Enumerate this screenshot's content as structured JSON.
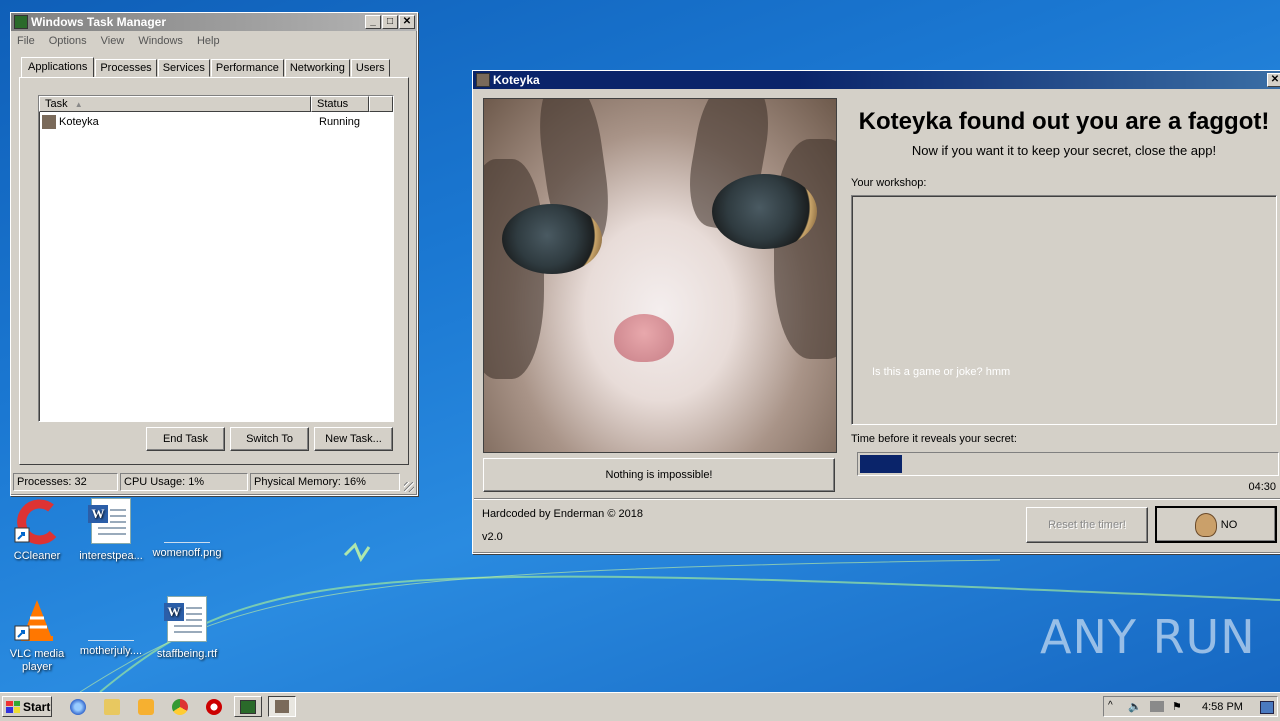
{
  "desktop": {
    "icons": [
      {
        "label": "CCleaner",
        "icon": "ccleaner-icon"
      },
      {
        "label": "interestpea...",
        "icon": "word-doc-icon"
      },
      {
        "label": "womenoff.png",
        "icon": "png-file-icon"
      },
      {
        "label": "VLC media player",
        "icon": "vlc-icon"
      },
      {
        "label": "motherjuly....",
        "icon": "file-icon"
      },
      {
        "label": "staffbeing.rtf",
        "icon": "word-doc-icon"
      }
    ],
    "watermark": "ANY RUN"
  },
  "taskmgr": {
    "title": "Windows Task Manager",
    "menu": [
      "File",
      "Options",
      "View",
      "Windows",
      "Help"
    ],
    "tabs": [
      "Applications",
      "Processes",
      "Services",
      "Performance",
      "Networking",
      "Users"
    ],
    "columns": [
      "Task",
      "Status"
    ],
    "rows": [
      {
        "task": "Koteyka",
        "status": "Running"
      }
    ],
    "buttons": {
      "end": "End Task",
      "switch": "Switch To",
      "new": "New Task..."
    },
    "status": {
      "processes": "Processes: 32",
      "cpu": "CPU Usage: 1%",
      "memory": "Physical Memory: 16%"
    }
  },
  "koteyka": {
    "title": "Koteyka",
    "heading": "Koteyka found out you are a faggot!",
    "subheading": "Now if you want it to keep your secret, close the app!",
    "workshop_label": "Your workshop:",
    "workshop_text": "Is this a game or joke? hmm",
    "nothing_button": "Nothing is impossible!",
    "timer_label": "Time before it reveals your secret:",
    "progress": 0.1,
    "time": "04:30",
    "credits": "Hardcoded by Enderman © 2018",
    "version": "v2.0",
    "reset_button": "Reset the timer!",
    "no_button": "NO"
  },
  "taskbar": {
    "start": "Start",
    "clock": "4:58 PM"
  },
  "colors": {
    "progress": "#0a246a",
    "window": "#d4d0c8"
  }
}
